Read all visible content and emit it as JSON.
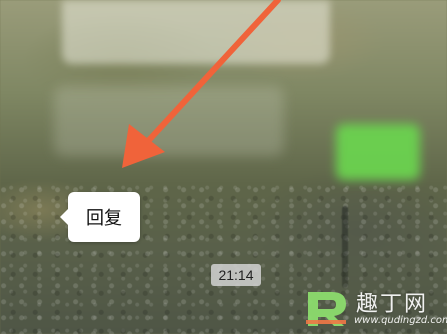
{
  "context_menu": {
    "reply_label": "回复"
  },
  "chat": {
    "timestamp": "21:14"
  },
  "annotation": {
    "arrow_color": "#f0633a"
  },
  "watermark": {
    "brand": "趣丁网",
    "url": "www.qudingzd.com"
  },
  "colors": {
    "green_bubble": "#6bd34f",
    "popup_bg": "#ffffff",
    "timestamp_bg": "#d2d2d2"
  }
}
